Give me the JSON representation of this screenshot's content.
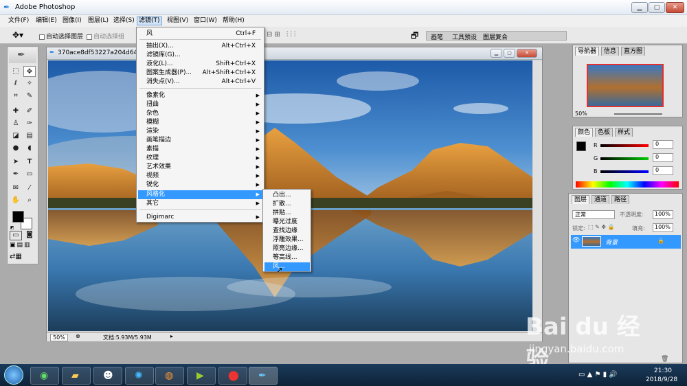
{
  "app": {
    "title": "Adobe Photoshop"
  },
  "menubar": [
    "文件(F)",
    "编辑(E)",
    "图像(I)",
    "图层(L)",
    "选择(S)",
    "滤镜(T)",
    "视图(V)",
    "窗口(W)",
    "帮助(H)"
  ],
  "options": {
    "auto_select_layer": "自动选择图层",
    "auto_select_group": "自动选择组",
    "tabs": [
      "画笔",
      "工具预设",
      "图层复合"
    ]
  },
  "document": {
    "title": "370ace8df53227a204d64c",
    "zoom": "50%",
    "doc_size": "文档:5.93M/5.93M"
  },
  "filter_menu": {
    "last_filter": {
      "label": "风",
      "shortcut": "Ctrl+F"
    },
    "group1": [
      {
        "label": "抽出(X)...",
        "shortcut": "Alt+Ctrl+X"
      },
      {
        "label": "滤镜库(G)...",
        "shortcut": ""
      },
      {
        "label": "液化(L)...",
        "shortcut": "Shift+Ctrl+X"
      },
      {
        "label": "图案生成器(P)...",
        "shortcut": "Alt+Shift+Ctrl+X"
      },
      {
        "label": "消失点(V)...",
        "shortcut": "Alt+Ctrl+V"
      }
    ],
    "group2": [
      "像素化",
      "扭曲",
      "杂色",
      "模糊",
      "渲染",
      "画笔描边",
      "素描",
      "纹理",
      "艺术效果",
      "视频",
      "锐化",
      "风格化",
      "其它"
    ],
    "group3": [
      "Digimarc"
    ]
  },
  "stylize_submenu": [
    "凸出...",
    "扩散...",
    "拼贴...",
    "曝光过度",
    "查找边缘",
    "浮雕效果...",
    "照亮边缘...",
    "等高线...",
    "风..."
  ],
  "navigator": {
    "tabs": [
      "导航器",
      "信息",
      "直方图"
    ],
    "zoom": "50%"
  },
  "color_panel": {
    "tabs": [
      "颜色",
      "色板",
      "样式"
    ],
    "r_label": "R",
    "g_label": "G",
    "b_label": "B",
    "r": "0",
    "g": "0",
    "b": "0"
  },
  "layers_panel": {
    "tabs": [
      "图层",
      "通道",
      "路径"
    ],
    "blend_mode": "正常",
    "opacity_label": "不透明度:",
    "opacity": "100%",
    "lock_label": "锁定:",
    "fill_label": "填充:",
    "fill": "100%",
    "layer_name": "背景"
  },
  "watermark": {
    "brand": "Bai du 经验",
    "url": "jingyan.baidu.com"
  },
  "taskbar": {
    "time": "21:30",
    "date": "2018/9/28"
  },
  "colors": {
    "menu_highlight": "#3399ff",
    "toolbar_bg": "#e6e6e6",
    "taskbar_bg": "#0e2338"
  }
}
